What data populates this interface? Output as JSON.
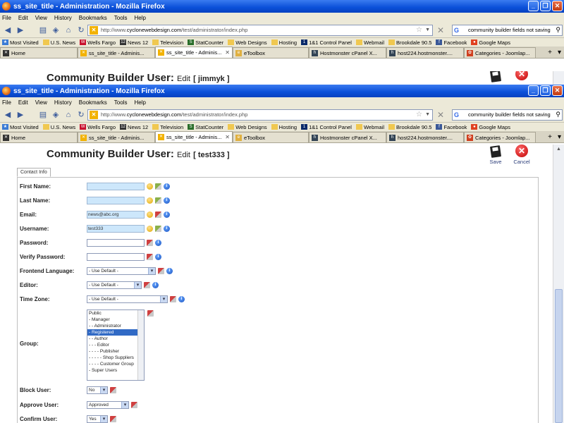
{
  "browser": {
    "title": "ss_site_title - Administration - Mozilla Firefox",
    "window_buttons": {
      "minimize": "_",
      "maximize": "❐",
      "close": "✕"
    },
    "menu": [
      "File",
      "Edit",
      "View",
      "History",
      "Bookmarks",
      "Tools",
      "Help"
    ],
    "url_prefix": "http://www.",
    "url_host": "cyclonewebdesign.com",
    "url_path": "/test/administrator/index.php",
    "search_value": "community builder fields not saving",
    "bookmarks": [
      {
        "label": "Most Visited",
        "icon": "star-icon"
      },
      {
        "label": "U.S. News",
        "icon": "folder-icon"
      },
      {
        "label": "Wells Fargo",
        "icon": "wellsfargo-icon"
      },
      {
        "label": "News 12",
        "icon": "news12-icon"
      },
      {
        "label": "Television",
        "icon": "folder-icon"
      },
      {
        "label": "StatCounter",
        "icon": "statcounter-icon"
      },
      {
        "label": "Web Designs",
        "icon": "folder-icon"
      },
      {
        "label": "Hosting",
        "icon": "folder-icon"
      },
      {
        "label": "1&1 Control Panel",
        "icon": "oneandone-icon"
      },
      {
        "label": "Webmail",
        "icon": "folder-icon"
      },
      {
        "label": "Brookdale 90.5",
        "icon": "folder-icon"
      },
      {
        "label": "Facebook",
        "icon": "facebook-icon"
      },
      {
        "label": "Google Maps",
        "icon": "google-maps-icon"
      }
    ],
    "tabs": [
      {
        "label": "Home"
      },
      {
        "label": "ss_site_title - Adminis..."
      },
      {
        "label": "ss_site_title - Adminis..."
      },
      {
        "label": "eToolbox"
      },
      {
        "label": "Hostmonster cPanel X..."
      },
      {
        "label": "host224.hostmonster...."
      },
      {
        "label": "Categories - Joomlap..."
      }
    ],
    "tab_new": "+",
    "tab_list": "▾"
  },
  "page_a": {
    "heading": "Community Builder User:",
    "edit_label": "Edit",
    "username_bracket": "[ jimmyk ]"
  },
  "page_b": {
    "heading": "Community Builder User:",
    "edit_label": "Edit",
    "username_bracket": "[ test333 ]",
    "save_label": "Save",
    "cancel_label": "Cancel",
    "tab_label": "Contact Info",
    "fields": {
      "first_name": {
        "label": "First Name:",
        "value": ""
      },
      "last_name": {
        "label": "Last Name:",
        "value": ""
      },
      "email": {
        "label": "Email:",
        "value": "news@abc.org"
      },
      "username": {
        "label": "Username:",
        "value": "test333"
      },
      "password": {
        "label": "Password:",
        "value": ""
      },
      "verify_password": {
        "label": "Verify Password:",
        "value": ""
      },
      "frontend_language": {
        "label": "Frontend Language:",
        "value": "- Use Default -"
      },
      "editor": {
        "label": "Editor:",
        "value": "- Use Default -"
      },
      "time_zone": {
        "label": "Time Zone:",
        "value": "- Use Default -"
      },
      "group": {
        "label": "Group:",
        "options": [
          "Public",
          "- Manager",
          "- - Administrator",
          "- Registered",
          "- - Author",
          "- - - Editor",
          "- - - - Publisher",
          "- - - - - Shop Suppliers",
          "- - - - Customer Group",
          "- Super Users"
        ],
        "selected_index": 3
      },
      "block_user": {
        "label": "Block User:",
        "value": "No"
      },
      "approve_user": {
        "label": "Approve User:",
        "value": "Approved"
      },
      "confirm_user": {
        "label": "Confirm User:",
        "value": "Yes"
      }
    }
  }
}
